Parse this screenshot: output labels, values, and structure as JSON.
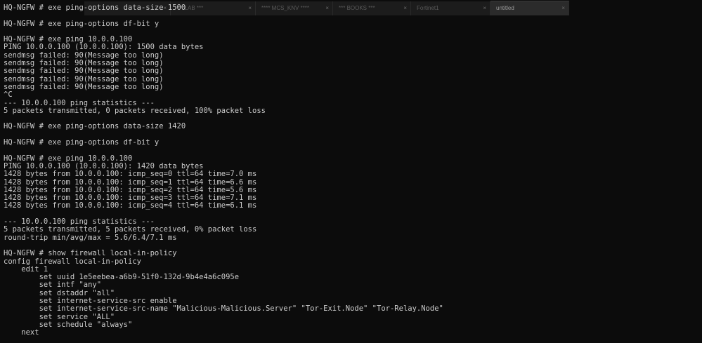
{
  "tabs": [
    {
      "label": "",
      "close": "×"
    },
    {
      "label": "*** LAB ***",
      "close": "×"
    },
    {
      "label": "**** MCS_KNV ****",
      "close": "×"
    },
    {
      "label": "*** BOOKS ***",
      "close": "×"
    },
    {
      "label": "Fortinet1",
      "close": "×"
    },
    {
      "label": "untitled",
      "close": "×"
    }
  ],
  "terminal_lines": [
    "HQ-NGFW # exe ping-options data-size 1500",
    "",
    "HQ-NGFW # exe ping-options df-bit y",
    "",
    "HQ-NGFW # exe ping 10.0.0.100",
    "PING 10.0.0.100 (10.0.0.100): 1500 data bytes",
    "sendmsg failed: 90(Message too long)",
    "sendmsg failed: 90(Message too long)",
    "sendmsg failed: 90(Message too long)",
    "sendmsg failed: 90(Message too long)",
    "sendmsg failed: 90(Message too long)",
    "^C",
    "--- 10.0.0.100 ping statistics ---",
    "5 packets transmitted, 0 packets received, 100% packet loss",
    "",
    "HQ-NGFW # exe ping-options data-size 1420",
    "",
    "HQ-NGFW # exe ping-options df-bit y",
    "",
    "HQ-NGFW # exe ping 10.0.0.100",
    "PING 10.0.0.100 (10.0.0.100): 1420 data bytes",
    "1428 bytes from 10.0.0.100: icmp_seq=0 ttl=64 time=7.0 ms",
    "1428 bytes from 10.0.0.100: icmp_seq=1 ttl=64 time=6.6 ms",
    "1428 bytes from 10.0.0.100: icmp_seq=2 ttl=64 time=5.6 ms",
    "1428 bytes from 10.0.0.100: icmp_seq=3 ttl=64 time=7.1 ms",
    "1428 bytes from 10.0.0.100: icmp_seq=4 ttl=64 time=6.1 ms",
    "",
    "--- 10.0.0.100 ping statistics ---",
    "5 packets transmitted, 5 packets received, 0% packet loss",
    "round-trip min/avg/max = 5.6/6.4/7.1 ms",
    "",
    "HQ-NGFW # show firewall local-in-policy",
    "config firewall local-in-policy",
    "    edit 1",
    "        set uuid 1e5eebea-a6b9-51f0-132d-9b4e4a6c095e",
    "        set intf \"any\"",
    "        set dstaddr \"all\"",
    "        set internet-service-src enable",
    "        set internet-service-src-name \"Malicious-Malicious.Server\" \"Tor-Exit.Node\" \"Tor-Relay.Node\"",
    "        set service \"ALL\"",
    "        set schedule \"always\"",
    "    next"
  ]
}
